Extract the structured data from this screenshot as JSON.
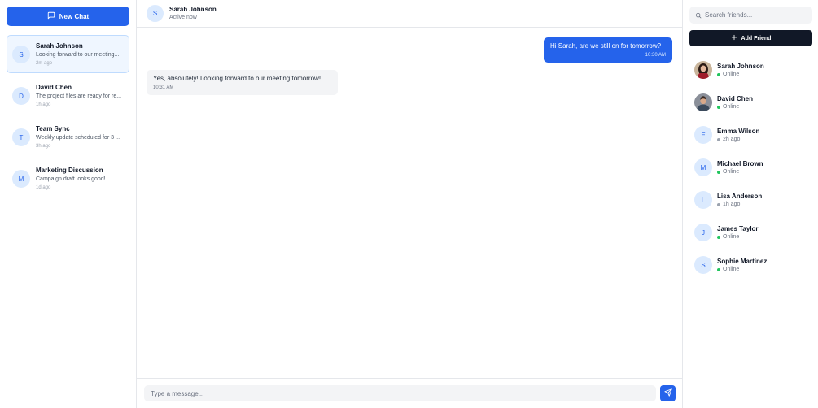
{
  "left": {
    "new_chat_label": "New Chat",
    "conversations": [
      {
        "initial": "S",
        "name": "Sarah Johnson",
        "preview": "Looking forward to our meeting...",
        "time": "2m ago"
      },
      {
        "initial": "D",
        "name": "David Chen",
        "preview": "The project files are ready for re...",
        "time": "1h ago"
      },
      {
        "initial": "T",
        "name": "Team Sync",
        "preview": "Weekly update scheduled for 3 ...",
        "time": "3h ago"
      },
      {
        "initial": "M",
        "name": "Marketing Discussion",
        "preview": "Campaign draft looks good!",
        "time": "1d ago"
      }
    ]
  },
  "chat": {
    "header": {
      "initial": "S",
      "name": "Sarah Johnson",
      "status": "Active now"
    },
    "messages": [
      {
        "text": "Hi Sarah, are we still on for tomorrow?",
        "time": "10:30 AM",
        "direction": "outgoing"
      },
      {
        "text": "Yes, absolutely! Looking forward to our meeting tomorrow!",
        "time": "10:31 AM",
        "direction": "incoming"
      }
    ],
    "composer": {
      "placeholder": "Type a message..."
    }
  },
  "right": {
    "search_placeholder": "Search friends...",
    "add_friend_label": "Add Friend",
    "friends": [
      {
        "initial": "",
        "name": "Sarah Johnson",
        "status": "Online",
        "has_photo": true
      },
      {
        "initial": "",
        "name": "David Chen",
        "status": "Online",
        "has_photo": true
      },
      {
        "initial": "E",
        "name": "Emma Wilson",
        "status": "2h ago",
        "has_photo": false
      },
      {
        "initial": "M",
        "name": "Michael Brown",
        "status": "Online",
        "has_photo": false
      },
      {
        "initial": "L",
        "name": "Lisa Anderson",
        "status": "1h ago",
        "has_photo": false
      },
      {
        "initial": "J",
        "name": "James Taylor",
        "status": "Online",
        "has_photo": false
      },
      {
        "initial": "S",
        "name": "Sophie Martinez",
        "status": "Online",
        "has_photo": false
      }
    ]
  },
  "colors": {
    "accent": "#2563eb",
    "online": "#22c55e",
    "away": "#9ca3af",
    "dark_button": "#111827"
  }
}
